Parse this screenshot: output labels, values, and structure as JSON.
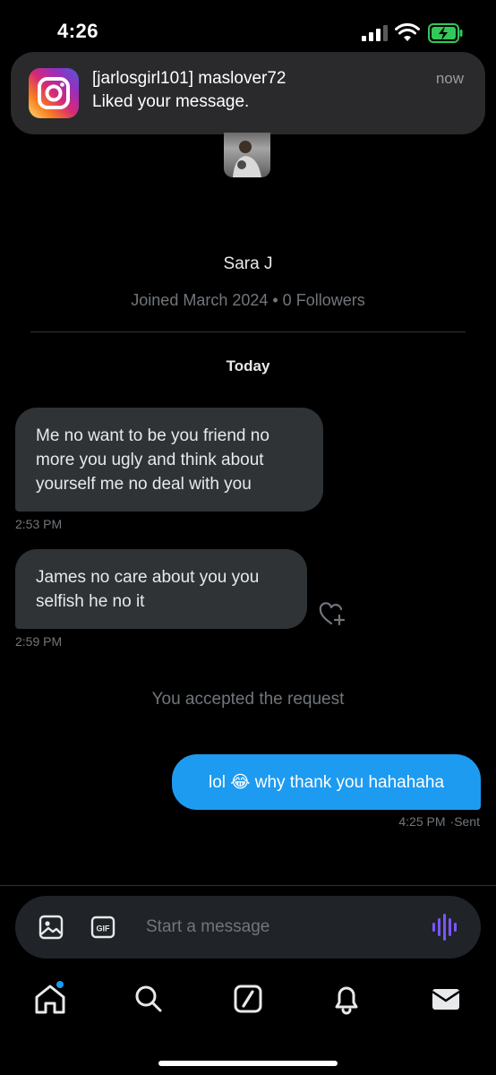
{
  "status_bar": {
    "time": "4:26"
  },
  "notification": {
    "app_icon": "instagram-icon",
    "title": "[jarlosgirl101] maslover72",
    "body": "Liked your message.",
    "time": "now"
  },
  "profile": {
    "name": "Sara J",
    "meta": "Joined March 2024 • 0 Followers"
  },
  "conversation": {
    "day_label": "Today",
    "received": [
      {
        "text": "Me no want to be you friend no more you ugly and think about yourself me no deal with you",
        "time": "2:53 PM"
      },
      {
        "text": "James no care about you you selfish he no it",
        "time": "2:59 PM"
      }
    ],
    "system_message": "You accepted the request",
    "sent": [
      {
        "text": "lol 😂 why thank you hahahaha",
        "time": "4:25 PM",
        "status": "Sent"
      }
    ]
  },
  "composer": {
    "placeholder": "Start a message"
  },
  "tab_bar": {
    "icons": [
      "home-icon",
      "search-icon",
      "grok-icon",
      "bell-icon",
      "mail-icon"
    ]
  },
  "colors": {
    "background": "#000000",
    "received_bubble": "#2f3336",
    "sent_bubble": "#1d9bf0",
    "accent": "#7856ff"
  }
}
